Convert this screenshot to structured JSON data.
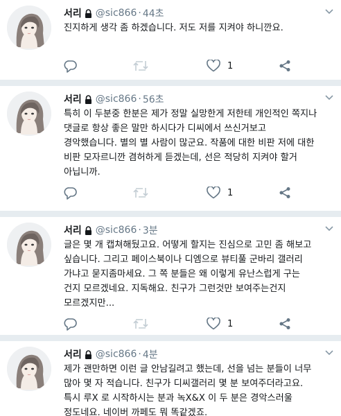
{
  "tweets": [
    {
      "name": "서리",
      "handle": "@sic866",
      "dot": "·",
      "time": "44초",
      "lines": [
        "진지하게 생각 좀 하겠습니다. 저도 저를 지켜야 하니깐요."
      ],
      "like_count": "1"
    },
    {
      "name": "서리",
      "handle": "@sic866",
      "dot": "·",
      "time": "56초",
      "lines": [
        "특히 이 두분중 한분은 제가 정말 실망한게 저한테 개인적인 쪽지나",
        "댓글로 항상 좋은 말만 하시다가 디씨에서 쓰신거보고",
        "경악했습니다.  별의 별 사람이 많군요. 작품에 대한 비판 저에 대한",
        "비판 모자르니깐 겸허하게 듣겠는데, 선은 적당히 지켜야 할거",
        "아닙니까."
      ],
      "like_count": "1"
    },
    {
      "name": "서리",
      "handle": "@sic866",
      "dot": "·",
      "time": "3분",
      "lines": [
        "글은 몇 개 캡쳐해뒀고요. 어떻게 할지는 진심으로 고민 좀 해보고",
        "싶습니다. 그리고 페이스북이나 디엠으로 뷰티풀 군바리 갤러리",
        "가냐고 묻지좀마세요. 그 쪽 분들은 왜 이렇게 유난스럽게 구는",
        "건지 모르겠네요. 지독해요. 친구가 그런것만 보여주는건지",
        "모르겠지만..."
      ],
      "like_count": "1"
    },
    {
      "name": "서리",
      "handle": "@sic866",
      "dot": "·",
      "time": "4분",
      "lines": [
        "제가 괜만하면 이런 글 안남길려고 했는데, 선을 넘는 분들이 너무",
        "많아 몇 자 적습니다. 친구가 디씨갤러리 몇 분 보여주더라고요.",
        "특시 루X 로 시작하시는 분과 녹X&X 이 두 분은  경악스러울",
        "정도네요. 네이버 까페도 뭐 똑같겠죠."
      ],
      "like_count": ""
    }
  ],
  "icons": {
    "reply": "reply-icon",
    "retweet": "retweet-icon",
    "like": "heart-icon",
    "share": "share-icon",
    "lock": "lock-icon",
    "caret": "chevron-down-icon"
  },
  "colors": {
    "text": "#14171a",
    "secondary": "#657786",
    "divider": "#e6ecf0"
  }
}
